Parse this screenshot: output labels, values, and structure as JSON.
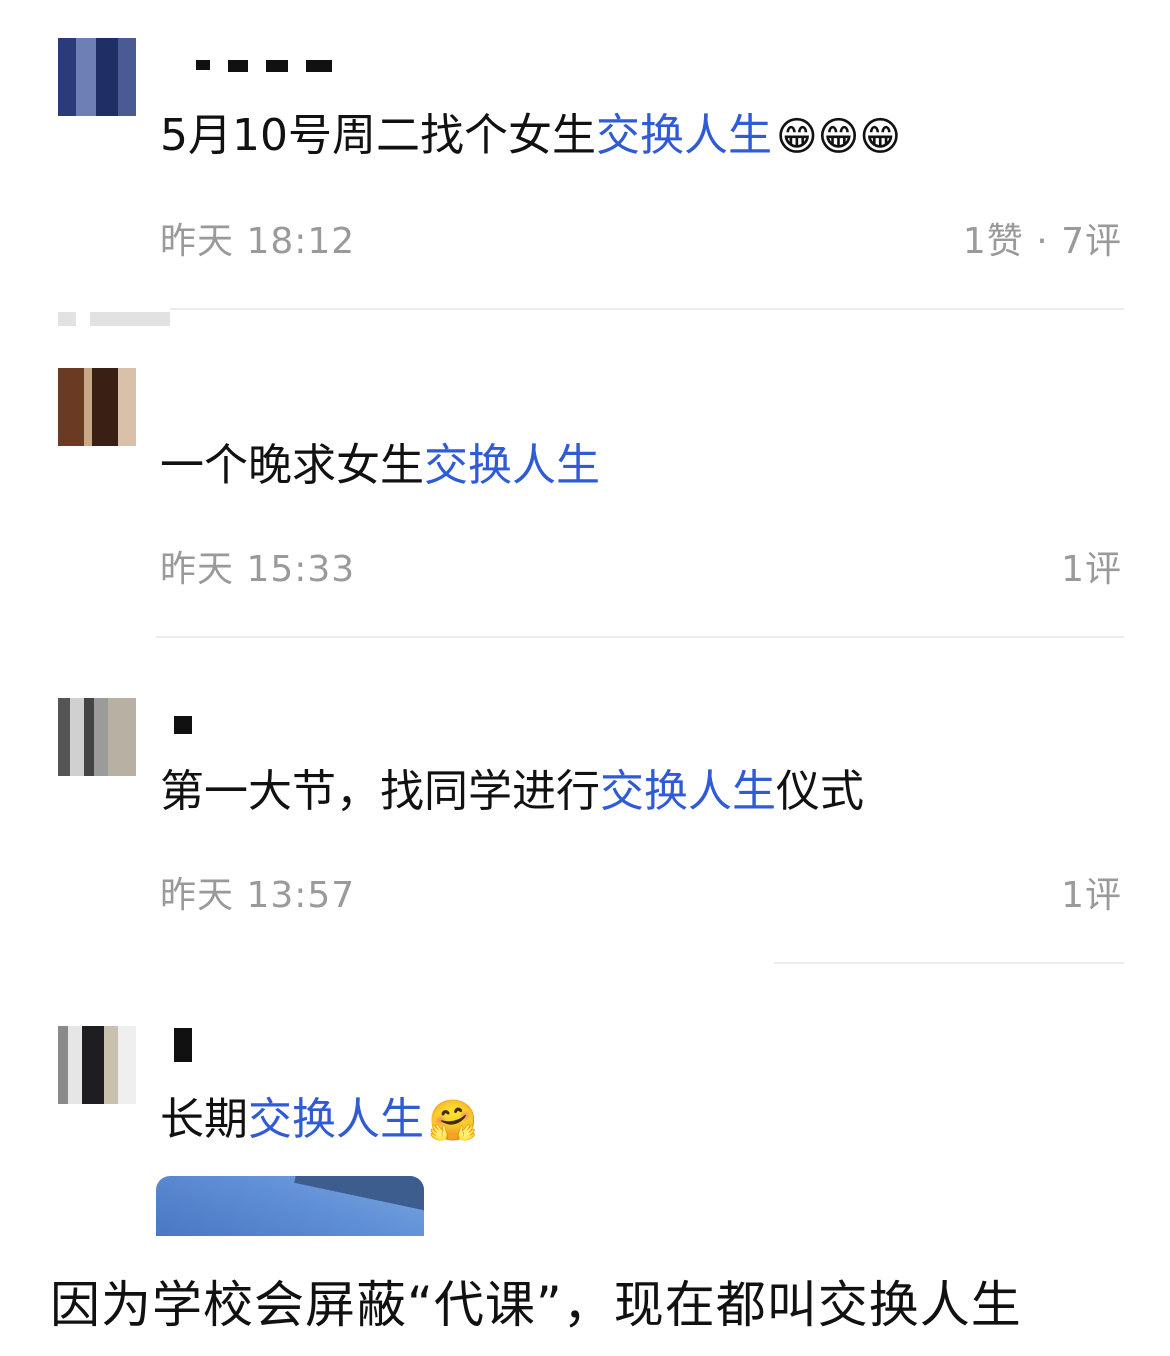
{
  "posts": [
    {
      "text_prefix": "5月10号周二找个女生",
      "keyword": "交换人生",
      "emoji": "😁😁😁",
      "time": "昨天 18:12",
      "stats": "1赞 · 7评"
    },
    {
      "text_prefix": "一个晚求女生",
      "keyword": "交换人生",
      "text_suffix": "",
      "time": "昨天 15:33",
      "stats": "1评"
    },
    {
      "text_prefix": "第一大节，找同学进行",
      "keyword": "交换人生",
      "text_suffix": "仪式",
      "time": "昨天 13:57",
      "stats": "1评"
    },
    {
      "text_prefix": "长期",
      "keyword": "交换人生",
      "emoji": "🤗"
    }
  ],
  "caption": "因为学校会屏蔽“代课”，现在都叫交换人生",
  "colors": {
    "keyword": "#2f5bd6",
    "meta": "#9a9a9a"
  }
}
